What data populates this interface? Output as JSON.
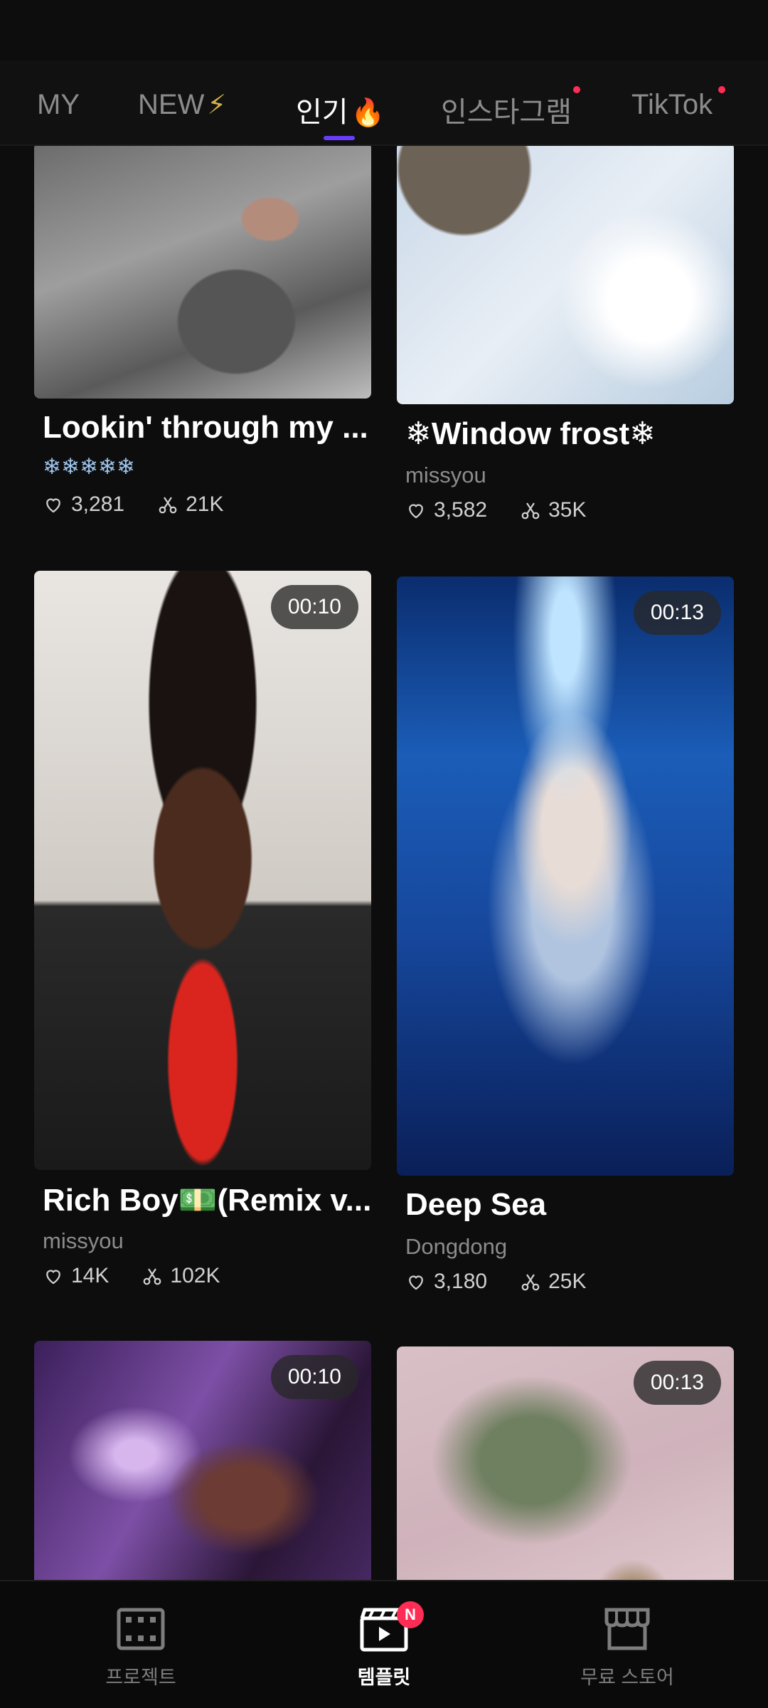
{
  "tabs": [
    {
      "label": "MY",
      "glyph": ""
    },
    {
      "label": "NEW",
      "glyph": "⚡"
    },
    {
      "label": "인기",
      "glyph": "🔥"
    },
    {
      "label": "인스타그램",
      "glyph": ""
    },
    {
      "label": "TikTok",
      "glyph": ""
    }
  ],
  "active_tab": "인기",
  "colors": {
    "accent": "#6a3cff",
    "badge": "#ff2d55",
    "background": "#0d0d0d"
  },
  "cards": [
    {
      "title": "Lookin' through my ...",
      "author": "❄❄❄❄❄",
      "likes": "3,281",
      "uses": "21K",
      "duration": ""
    },
    {
      "title": "❄Window frost❄",
      "author": "missyou",
      "likes": "3,582",
      "uses": "35K",
      "duration": ""
    },
    {
      "title": "Rich Boy💵(Remix v...",
      "author": "missyou",
      "likes": "14K",
      "uses": "102K",
      "duration": "00:10"
    },
    {
      "title": "Deep Sea",
      "author": "Dongdong",
      "likes": "3,180",
      "uses": "25K",
      "duration": "00:13"
    },
    {
      "title": "",
      "author": "",
      "likes": "",
      "uses": "",
      "duration": "00:10"
    },
    {
      "title": "",
      "author": "",
      "likes": "",
      "uses": "",
      "duration": "00:13"
    }
  ],
  "bottom_nav": [
    {
      "label": "프로젝트",
      "icon": "film-icon"
    },
    {
      "label": "템플릿",
      "icon": "clapperboard-icon",
      "badge": "N"
    },
    {
      "label": "무료 스토어",
      "icon": "store-icon"
    }
  ]
}
